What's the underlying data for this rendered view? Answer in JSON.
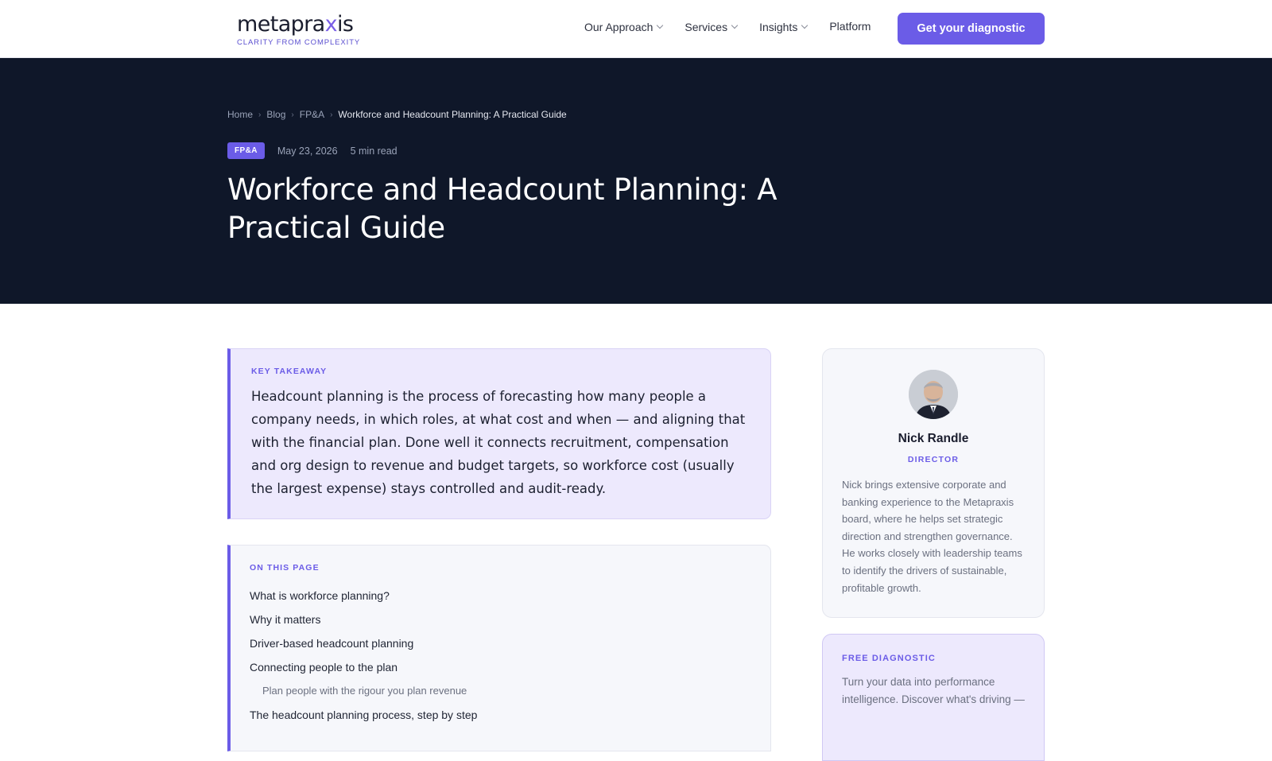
{
  "nav": {
    "logo_text_a": "metapra",
    "logo_text_x": "x",
    "logo_text_b": "is",
    "logo_tagline": "CLARITY FROM COMPLEXITY",
    "links": [
      {
        "label": "Our Approach"
      },
      {
        "label": "Services"
      },
      {
        "label": "Insights"
      },
      {
        "label": "Platform"
      }
    ],
    "cta_label": "Get your diagnostic"
  },
  "breadcrumb": {
    "items": [
      "Home",
      "Blog",
      "FP&A"
    ],
    "current": "Workforce and Headcount Planning: A Practical Guide"
  },
  "article": {
    "category": "FP&A",
    "date": "May 23, 2026",
    "read_time": "5 min read",
    "title": "Workforce and Headcount Planning: A Practical Guide"
  },
  "takeaway": {
    "eyebrow": "KEY TAKEAWAY",
    "text": "Headcount planning is the process of forecasting how many people a company needs, in which roles, at what cost and when — and aligning that with the financial plan. Done well it connects recruitment, compensation and org design to revenue and budget targets, so workforce cost (usually the largest expense) stays controlled and audit-ready."
  },
  "toc": {
    "eyebrow": "ON THIS PAGE",
    "items": [
      "What is workforce planning?",
      "Why it matters",
      "Driver-based headcount planning",
      "Connecting people to the plan"
    ],
    "sub_item": "Plan people with the rigour you plan revenue",
    "next_item": "The headcount planning process, step by step"
  },
  "author": {
    "name": "Nick Randle",
    "role": "DIRECTOR",
    "bio": "Nick brings extensive corporate and banking experience to the Metapraxis board, where he helps set strategic direction and strengthen governance. He works closely with leadership teams to identify the drivers of sustainable, profitable growth."
  },
  "diagnostic": {
    "eyebrow": "FREE DIAGNOSTIC",
    "text": "Turn your data into performance intelligence. Discover what's driving —"
  },
  "colors": {
    "accent": "#6b5ce7",
    "hero_bg": "#0f1729",
    "tint": "#ede9fd"
  }
}
